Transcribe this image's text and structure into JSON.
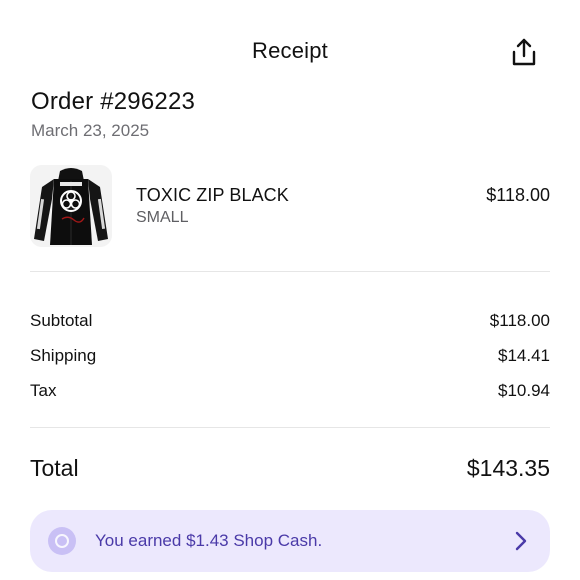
{
  "header": {
    "title": "Receipt",
    "share_icon": "share-icon"
  },
  "order": {
    "title": "Order #296223",
    "date": "March 23, 2025"
  },
  "item": {
    "name": "TOXIC ZIP BLACK",
    "variant": "SMALL",
    "price": "$118.00",
    "image_icon": "hoodie-product-image"
  },
  "summary": {
    "subtotal_label": "Subtotal",
    "subtotal_value": "$118.00",
    "shipping_label": "Shipping",
    "shipping_value": "$14.41",
    "tax_label": "Tax",
    "tax_value": "$10.94",
    "total_label": "Total",
    "total_value": "$143.35"
  },
  "shop_cash": {
    "text": "You earned $1.43 Shop Cash.",
    "icon": "shop-cash-coin-icon",
    "chevron_icon": "chevron-right-icon"
  },
  "colors": {
    "banner_bg": "#ece8fd",
    "banner_text": "#4a3aa8",
    "muted_text": "#6e6e73"
  }
}
